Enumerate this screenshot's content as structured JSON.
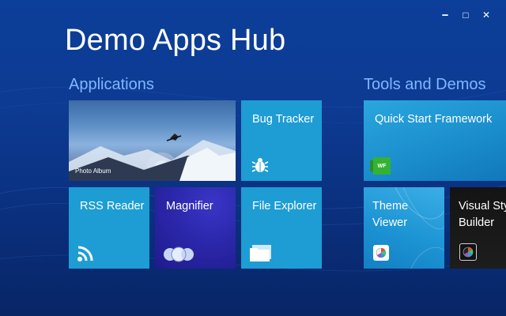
{
  "window": {
    "minimize_glyph": "🗕",
    "maximize_glyph": "□",
    "close_glyph": "✕"
  },
  "hub": {
    "title": "Demo Apps Hub"
  },
  "groups": {
    "applications": "Applications",
    "tools": "Tools and Demos"
  },
  "tiles": {
    "photo_album": {
      "label": "Photo Album",
      "icon": "photo-image"
    },
    "bug_tracker": {
      "label": "Bug Tracker",
      "icon": "bug-icon"
    },
    "quick_start": {
      "label": "Quick Start Framework",
      "icon": "wf-icon",
      "badge": "WF"
    },
    "rss_reader": {
      "label": "RSS Reader",
      "icon": "rss-icon"
    },
    "magnifier": {
      "label": "Magnifier",
      "icon": "magnifier-circles-icon"
    },
    "file_explorer": {
      "label": "File Explorer",
      "icon": "folder-icon"
    },
    "theme_viewer": {
      "label": "Theme\nViewer",
      "icon": "palette-icon"
    },
    "visual_style_builder": {
      "label": "Visual Style\nBuilder",
      "icon": "palette-icon"
    }
  },
  "colors": {
    "background": "#0c3f9a",
    "tile_blue": "#1d9dd3",
    "magnifier_purple": "#2a26a8",
    "group_title": "#7fb7ff",
    "wf_green": "#34b233"
  }
}
